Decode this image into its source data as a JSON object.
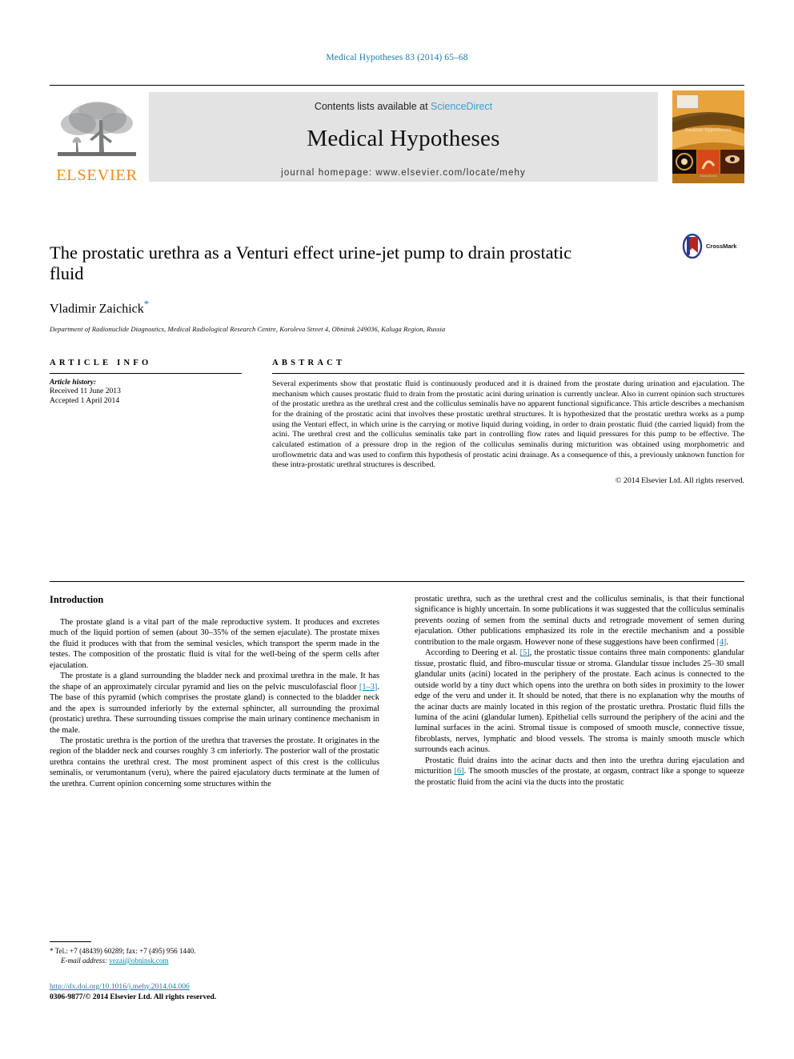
{
  "running_head": "Medical Hypotheses 83 (2014) 65–68",
  "masthead": {
    "publisher_wordmark": "ELSEVIER",
    "contents_prefix": "Contents lists available at",
    "contents_link": "ScienceDirect",
    "journal_title": "Medical Hypotheses",
    "homepage": "journal homepage: www.elsevier.com/locate/mehy",
    "cover_title": "medical hypotheses"
  },
  "article": {
    "title": "The prostatic urethra as a Venturi effect urine-jet pump to drain prostatic fluid",
    "author": "Vladimir Zaichick",
    "author_footnote_mark": "*",
    "affiliation": "Department of Radionuclide Diagnostics, Medical Radiological Research Centre, Koroleva Street 4, Obninsk 249036, Kaluga Region, Russia",
    "crossmark_label": "CrossMark"
  },
  "article_info": {
    "heading": "ARTICLE INFO",
    "history_label": "Article history:",
    "received": "Received 11 June 2013",
    "accepted": "Accepted 1 April 2014"
  },
  "abstract": {
    "heading": "ABSTRACT",
    "text": "Several experiments show that prostatic fluid is continuously produced and it is drained from the prostate during urination and ejaculation. The mechanism which causes prostatic fluid to drain from the prostatic acini during urination is currently unclear. Also in current opinion such structures of the prostatic urethra as the urethral crest and the colliculus seminalis have no apparent functional significance. This article describes a mechanism for the draining of the prostatic acini that involves these prostatic urethral structures. It is hypothesized that the prostatic urethra works as a pump using the Venturi effect, in which urine is the carrying or motive liquid during voiding, in order to drain prostatic fluid (the carried liquid) from the acini. The urethral crest and the colliculus seminalis take part in controlling flow rates and liquid pressures for this pump to be effective. The calculated estimation of a pressure drop in the region of the colliculus seminalis during micturition was obtained using morphometric and uroflowmetric data and was used to confirm this hypothesis of prostatic acini drainage. As a consequence of this, a previously unknown function for these intra-prostatic urethral structures is described.",
    "copyright": "© 2014 Elsevier Ltd. All rights reserved."
  },
  "body": {
    "section_heading": "Introduction",
    "left_paragraphs": [
      "The prostate gland is a vital part of the male reproductive system. It produces and excretes much of the liquid portion of semen (about 30–35% of the semen ejaculate). The prostate mixes the fluid it produces with that from the seminal vesicles, which transport the sperm made in the testes. The composition of the prostatic fluid is vital for the well-being of the sperm cells after ejaculation.",
      "The prostate is a gland surrounding the bladder neck and proximal urethra in the male. It has the shape of an approximately circular pyramid and lies on the pelvic musculofascial floor [1–3]. The base of this pyramid (which comprises the prostate gland) is connected to the bladder neck and the apex is surrounded inferiorly by the external sphincter, all surrounding the proximal (prostatic) urethra. These surrounding tissues comprise the main urinary continence mechanism in the male.",
      "The prostatic urethra is the portion of the urethra that traverses the prostate. It originates in the region of the bladder neck and courses roughly 3 cm inferiorly. The posterior wall of the prostatic urethra contains the urethral crest. The most prominent aspect of this crest is the colliculus seminalis, or verumontanum (veru), where the paired ejaculatory ducts terminate at the lumen of the urethra. Current opinion concerning some structures within the"
    ],
    "right_paragraphs": [
      "prostatic urethra, such as the urethral crest and the colliculus seminalis, is that their functional significance is highly uncertain. In some publications it was suggested that the colliculus seminalis prevents oozing of semen from the seminal ducts and retrograde movement of semen during ejaculation. Other publications emphasized its role in the erectile mechanism and a possible contribution to the male orgasm. However none of these suggestions have been confirmed [4].",
      "According to Deering et al. [5], the prostatic tissue contains three main components: glandular tissue, prostatic fluid, and fibro-muscular tissue or stroma. Glandular tissue includes 25–30 small glandular units (acini) located in the periphery of the prostate. Each acinus is connected to the outside world by a tiny duct which opens into the urethra on both sides in proximity to the lower edge of the veru and under it. It should be noted, that there is no explanation why the mouths of the acinar ducts are mainly located in this region of the prostatic urethra. Prostatic fluid fills the lumina of the acini (glandular lumen). Epithelial cells surround the periphery of the acini and the luminal surfaces in the acini. Stromal tissue is composed of smooth muscle, connective tissue, fibroblasts, nerves, lymphatic and blood vessels. The stroma is mainly smooth muscle which surrounds each acinus.",
      "Prostatic fluid drains into the acinar ducts and then into the urethra during ejaculation and micturition [6]. The smooth muscles of the prostate, at orgasm, contract like a sponge to squeeze the prostatic fluid from the acini via the ducts into the prostatic"
    ],
    "citations": [
      "[1–3]",
      "[4]",
      "[5]",
      "[6]"
    ]
  },
  "footnotes": {
    "corresponding_mark": "*",
    "tel_line": "Tel.: +7 (48439) 60289; fax: +7 (495) 956 1440.",
    "email_label": "E-mail address:",
    "email": "vezai@obninsk.com",
    "doi_url": "http://dx.doi.org/10.1016/j.mehy.2014.04.006",
    "issn_line": "0306-9877/© 2014 Elsevier Ltd. All rights reserved."
  },
  "colors": {
    "link": "#1a7ca6",
    "elsevier_orange": "#ED8B22",
    "sciencedirect_blue": "#3c9dd0",
    "banner_grey": "#e3e3e3"
  }
}
